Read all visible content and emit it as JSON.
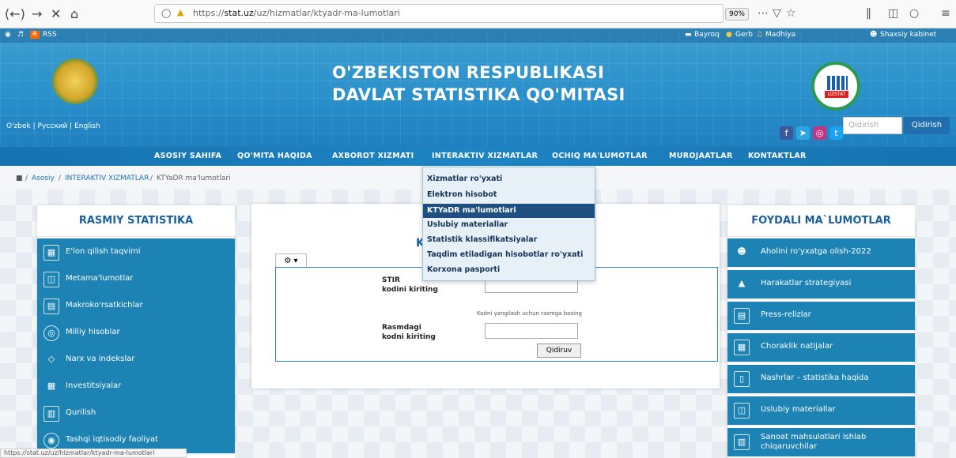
{
  "browser": {
    "url_prefix": "https://",
    "url_domain": "stat.uz",
    "url_path": "/uz/hizmatlar/ktyadr-ma-lumotlari",
    "zoom": "90%"
  },
  "topbar": {
    "rss": "RSS",
    "bayroq": "Bayroq",
    "gerb": "Gerb",
    "madhiya": "Madhiya",
    "cabinet": "Shaxsiy kabinet"
  },
  "header": {
    "title_line1": "O'ZBEKISTON RESPUBLIKASI",
    "title_line2": "DAVLAT STATISTIKA QO'MITASI",
    "logo_label": "UZSTAT",
    "lang_uz": "O'zbek",
    "lang_ru": "Русский",
    "lang_en": "English",
    "search_placeholder": "Qidirish",
    "search_button": "Qidirish"
  },
  "menu": [
    "ASOSIY SAHIFA",
    "QO'MITA HAQIDA",
    "AXBOROT XIZMATI",
    "INTERAKTIV XIZMATLAR",
    "OCHIQ MA'LUMOTLAR",
    "MUROJAATLAR",
    "KONTAKTLAR"
  ],
  "breadcrumb": [
    "Asosiy",
    "INTERAKTIV XIZMATLAR",
    "KTYaDR ma'lumotlari"
  ],
  "dropdown": [
    "Xizmatlar ro'yxati",
    "Elektron hisobot",
    "KTYaDR ma'lumotlari",
    "Uslubiy materiallar",
    "Statistik klassifikatsiyalar",
    "Taqdim etiladigan hisobotlar ro'yxati",
    "Korxona pasporti"
  ],
  "left_panel": {
    "title": "RASMIY STATISTIKA",
    "items": [
      "E'lon qilish taqvimi",
      "Metama'lumotlar",
      "Makroko'rsatkichlar",
      "Milliy hisoblar",
      "Narx va indekslar",
      "Investitsiyalar",
      "Qurilish",
      "Tashqi iqtisodiy faoliyat"
    ]
  },
  "right_panel": {
    "title": "FOYDALI MA`LUMOTLAR",
    "items": [
      "Aholini ro'yxatga olish-2022",
      "Harakatlar strategiyasi",
      "Press-relizlar",
      "Choraklik natijalar",
      "Nashrlar – statistika haqida",
      "Uslubiy materiallar",
      "Sanoat mahsulotlari ishlab chiqaruvchilar"
    ]
  },
  "form": {
    "title_letter": "K",
    "stir_label_1": "STIR",
    "stir_label_2": "kodini kiriting",
    "hint": "Kodni yangilash uchun rasmga bosing",
    "captcha_label_1": "Rasmdagi",
    "captcha_label_2": "kodni kiriting",
    "submit": "Qidiruv"
  },
  "status_url": "https://stat.uz/uz/hizmatlar/ktyadr-ma-lumotlari"
}
